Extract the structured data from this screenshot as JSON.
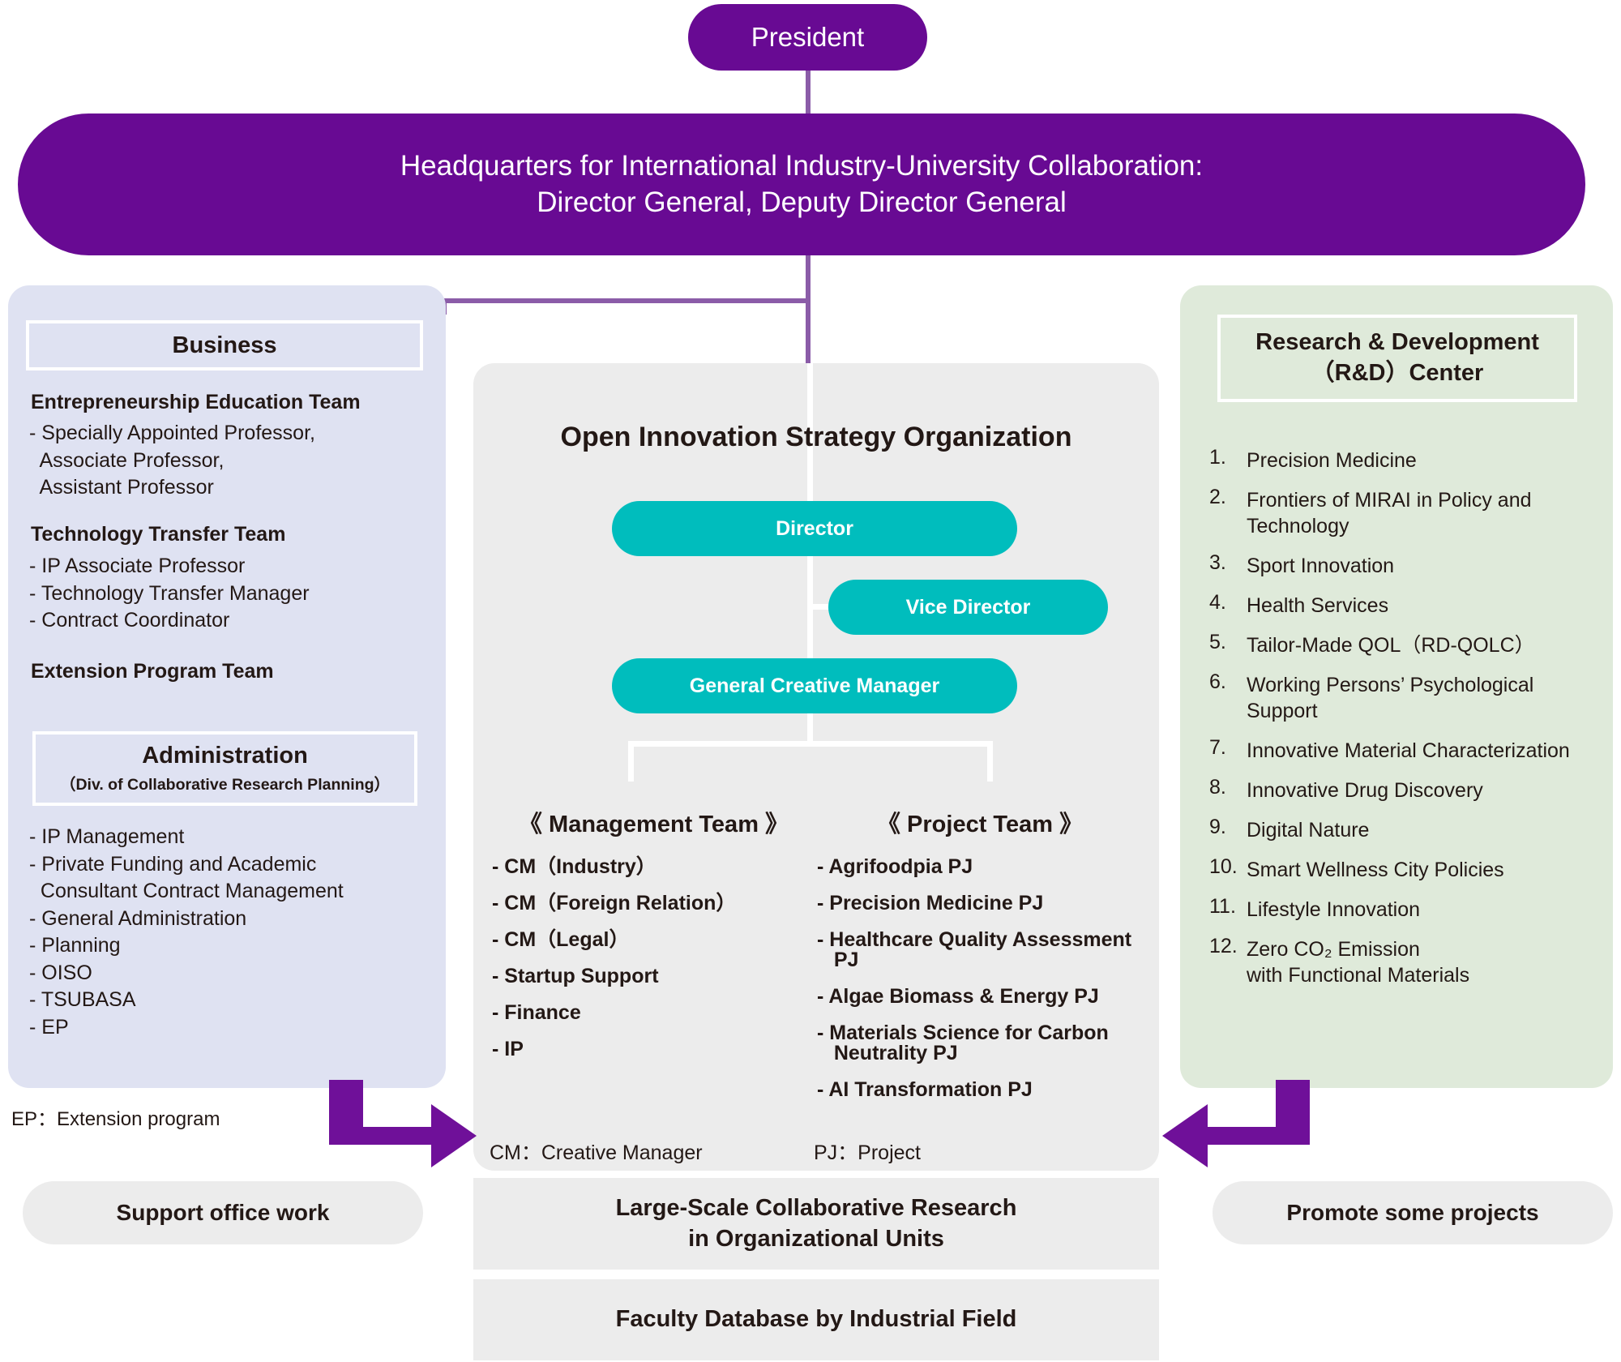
{
  "president": {
    "label": "President"
  },
  "headquarters": {
    "line1": "Headquarters for International Industry-University Collaboration:",
    "line2": "Director General, Deputy Director General"
  },
  "business_panel": {
    "title": "Business",
    "teams": [
      {
        "heading": "Entrepreneurship Education Team",
        "items": [
          "- Specially Appointed Professor,",
          "  Associate Professor,",
          "  Assistant Professor"
        ]
      },
      {
        "heading": "Technology Transfer Team",
        "items": [
          "- IP Associate Professor",
          "- Technology Transfer Manager",
          "- Contract Coordinator"
        ]
      },
      {
        "heading": "Extension Program Team",
        "items": []
      }
    ],
    "administration": {
      "title": "Administration",
      "subtitle": "（Div. of Collaborative Research Planning）",
      "items": [
        "- IP Management",
        "- Private Funding and Academic",
        "  Consultant Contract Management",
        "- General Administration",
        "- Planning",
        "- OISO",
        "- TSUBASA",
        "- EP"
      ]
    },
    "footnote": "EP：Extension program"
  },
  "center_panel": {
    "title": "Open Innovation Strategy Organization",
    "director": "Director",
    "vice_director": "Vice Director",
    "general_creative_manager": "General Creative Manager",
    "management_team": {
      "heading": "《 Management Team 》",
      "items": [
        "- CM（Industry）",
        "- CM（Foreign Relation）",
        "- CM（Legal）",
        "- Startup Support",
        "- Finance",
        "- IP"
      ],
      "legend": "CM：Creative Manager"
    },
    "project_team": {
      "heading": "《 Project Team 》",
      "items": [
        "- Agrifoodpia PJ",
        "- Precision Medicine PJ",
        "- Healthcare Quality Assessment\n   PJ",
        "- Algae Biomass & Energy PJ",
        "- Materials Science for Carbon\n   Neutrality PJ",
        "- AI Transformation PJ"
      ],
      "legend": "PJ：Project"
    }
  },
  "rd_panel": {
    "title_line1": "Research & Development",
    "title_line2": "（R&D）Center",
    "items": [
      {
        "num": "1.",
        "text": "Precision Medicine"
      },
      {
        "num": "2.",
        "text": "Frontiers of MIRAI in Policy and\nTechnology"
      },
      {
        "num": "3.",
        "text": "Sport Innovation"
      },
      {
        "num": "4.",
        "text": "Health Services"
      },
      {
        "num": "5.",
        "text": "Tailor-Made QOL（RD-QOLC）"
      },
      {
        "num": "6.",
        "text": "Working Persons’ Psychological\nSupport"
      },
      {
        "num": "7.",
        "text": "Innovative Material Characterization"
      },
      {
        "num": "8.",
        "text": "Innovative Drug Discovery"
      },
      {
        "num": "9.",
        "text": "Digital Nature"
      },
      {
        "num": "10.",
        "text": "Smart Wellness City Policies"
      },
      {
        "num": "11.",
        "text": "Lifestyle Innovation"
      },
      {
        "num": "12.",
        "text": "Zero CO₂ Emission\nwith Functional Materials"
      }
    ]
  },
  "bottom": {
    "chip_left": "Support office work",
    "chip_right": "Promote some projects",
    "bar_large_line1": "Large-Scale Collaborative Research",
    "bar_large_line2": "in Organizational Units",
    "bar_database": "Faculty Database by Industrial Field"
  },
  "colors": {
    "purple": "#680a93",
    "connector_purple": "#8b5ca8",
    "arrow_purple": "#6f1099",
    "teal": "#00bdbd",
    "panel_blue": "#dfe2f2",
    "panel_green": "#dfeada",
    "panel_grey": "#ececec",
    "text": "#231815"
  }
}
